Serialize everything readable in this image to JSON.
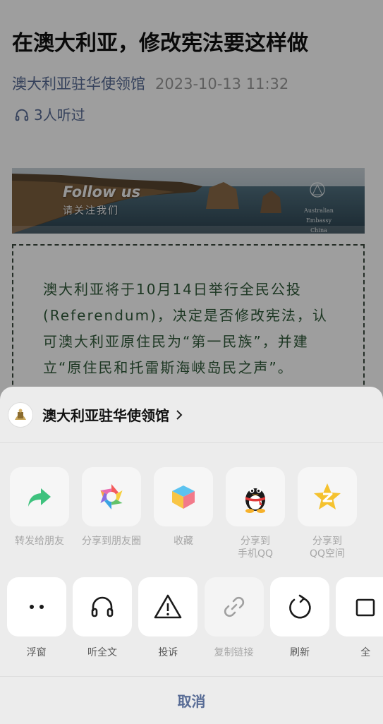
{
  "article": {
    "title": "在澳大利亚，修改宪法要这样做",
    "author": "澳大利亚驻华使领馆",
    "date": "2023-10-13 11:32",
    "listeners": "3人听过",
    "banner": {
      "follow": "Follow us",
      "sub": "请关注我们",
      "embassy_line1": "Australian Embassy",
      "embassy_line2": "China"
    },
    "intro": "澳大利亚将于10月14日举行全民公投(Referendum)，决定是否修改宪法，认可澳大利亚原住民为“第一民族”，并建立“原住民和托雷斯海峡岛民之声”。"
  },
  "sheet": {
    "account": "澳大利亚驻华使领馆",
    "share_row": [
      {
        "label": "转发给朋友",
        "icon": "forward-arrow-icon"
      },
      {
        "label": "分享到朋友圈",
        "icon": "moments-aperture-icon"
      },
      {
        "label": "收藏",
        "icon": "favorite-cube-icon"
      },
      {
        "label": "分享到\n手机QQ",
        "icon": "qq-penguin-icon"
      },
      {
        "label": "分享到\nQQ空间",
        "icon": "qzone-star-icon"
      }
    ],
    "action_row": [
      {
        "label": "浮窗",
        "icon": "float-window-icon"
      },
      {
        "label": "听全文",
        "icon": "headphones-icon"
      },
      {
        "label": "投诉",
        "icon": "warning-icon"
      },
      {
        "label": "复制链接",
        "icon": "link-icon"
      },
      {
        "label": "刷新",
        "icon": "refresh-icon"
      },
      {
        "label": "全",
        "icon": "fullscreen-icon"
      }
    ],
    "cancel": "取消"
  },
  "colors": {
    "link_blue": "#576b95",
    "forward_green": "#3ec27e",
    "qzone_yellow": "#f5c22e"
  }
}
